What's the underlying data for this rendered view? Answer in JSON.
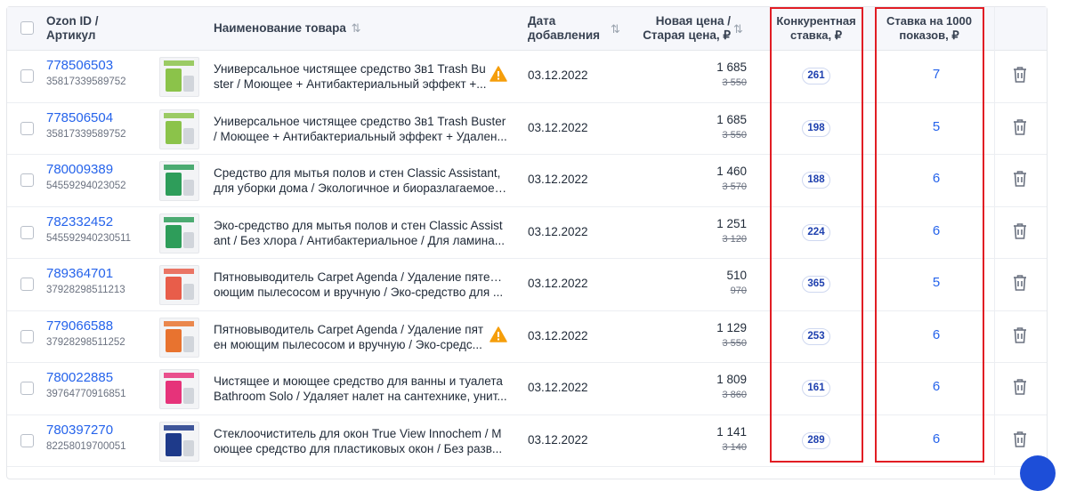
{
  "header": {
    "ozon_id": "Ozon ID /",
    "article": "Артикул",
    "product_name": "Наименование товара",
    "date_line1": "Дата",
    "date_line2": "добавления",
    "price_line1": "Новая цена /",
    "price_line2": "Старая цена, ₽",
    "competitive_line1": "Конкурентная",
    "competitive_line2": "ставка, ₽",
    "bid_line1": "Ставка на 1000",
    "bid_line2": "показов, ₽"
  },
  "icons": {
    "sort": "sort-arrows-icon",
    "warning": "warning-triangle-icon",
    "trash": "trash-icon"
  },
  "colors": {
    "link": "#2563eb",
    "warning": "#f59e0b",
    "highlight": "#e11d24"
  },
  "rows": [
    {
      "id": "778506503",
      "sku": "35817339589752",
      "name1": "Универсальное чистящее средство 3в1 Trash Bu",
      "name2": "ster / Моющее + Антибактериальный эффект +...",
      "warning": true,
      "date": "03.12.2022",
      "price": "1 685",
      "old_price": "3 550",
      "competitive": "261",
      "bid": "7"
    },
    {
      "id": "778506504",
      "sku": "35817339589752",
      "name1": "Универсальное чистящее средство 3в1 Trash Buster",
      "name2": "/ Моющее + Антибактериальный эффект + Удален...",
      "warning": false,
      "date": "03.12.2022",
      "price": "1 685",
      "old_price": "3 550",
      "competitive": "198",
      "bid": "5"
    },
    {
      "id": "780009389",
      "sku": "54559294023052",
      "name1": "Средство для мытья полов и стен Classic Assistant,",
      "name2": "для уборки дома / Экологичное и биоразлагаемое ...",
      "warning": false,
      "date": "03.12.2022",
      "price": "1 460",
      "old_price": "3 570",
      "competitive": "188",
      "bid": "6"
    },
    {
      "id": "782332452",
      "sku": "545592940230511",
      "name1": "Эко-средство для мытья полов и стен Classic Assist",
      "name2": "ant / Без хлора / Антибактериальное / Для ламина...",
      "warning": false,
      "date": "03.12.2022",
      "price": "1 251",
      "old_price": "3 120",
      "competitive": "224",
      "bid": "6"
    },
    {
      "id": "789364701",
      "sku": "37928298511213",
      "name1": "Пятновыводитель Carpet Agenda / Удаление пятен м",
      "name2": "оющим пылесосом и вручную / Эко-средство для ...",
      "warning": false,
      "date": "03.12.2022",
      "price": "510",
      "old_price": "970",
      "competitive": "365",
      "bid": "5"
    },
    {
      "id": "779066588",
      "sku": "37928298511252",
      "name1": "Пятновыводитель Carpet Agenda / Удаление пят",
      "name2": "ен моющим пылесосом и вручную / Эко-средс...",
      "warning": true,
      "date": "03.12.2022",
      "price": "1 129",
      "old_price": "3 550",
      "competitive": "253",
      "bid": "6"
    },
    {
      "id": "780022885",
      "sku": "39764770916851",
      "name1": "Чистящее и моющее средство для ванны и туалета",
      "name2": "Bathroom Solo / Удаляет налет на сантехнике, унит...",
      "warning": false,
      "date": "03.12.2022",
      "price": "1 809",
      "old_price": "3 860",
      "competitive": "161",
      "bid": "6"
    },
    {
      "id": "780397270",
      "sku": "82258019700051",
      "name1": "Стеклоочиститель для окон True View Innochem / М",
      "name2": "оющее средство для пластиковых окон / Без разв...",
      "warning": false,
      "date": "03.12.2022",
      "price": "1 141",
      "old_price": "3 140",
      "competitive": "289",
      "bid": "6"
    }
  ]
}
